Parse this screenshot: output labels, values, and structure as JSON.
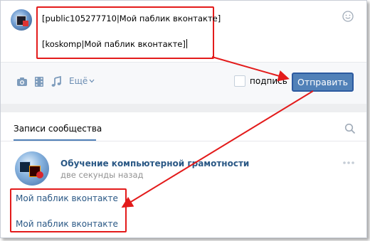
{
  "composer": {
    "line1": "[public105277710|Мой паблик вконтакте]",
    "line2": "[koskomp|Мой паблик вконтакте]"
  },
  "toolbar": {
    "icons": [
      "camera-icon",
      "video-icon",
      "music-icon"
    ],
    "more_label": "Ещё",
    "signature_label": "подпись",
    "send_label": "Отправить"
  },
  "feed": {
    "tab_label": "Записи сообщества"
  },
  "post": {
    "author": "Обучение компьютерной грамотности",
    "time": "две секунды назад",
    "lines": [
      "Мой паблик вконтакте",
      "Мой паблик вконтакте"
    ]
  },
  "colors": {
    "accent": "#5181b8",
    "link": "#2a5885",
    "highlight": "#e31b1b"
  }
}
